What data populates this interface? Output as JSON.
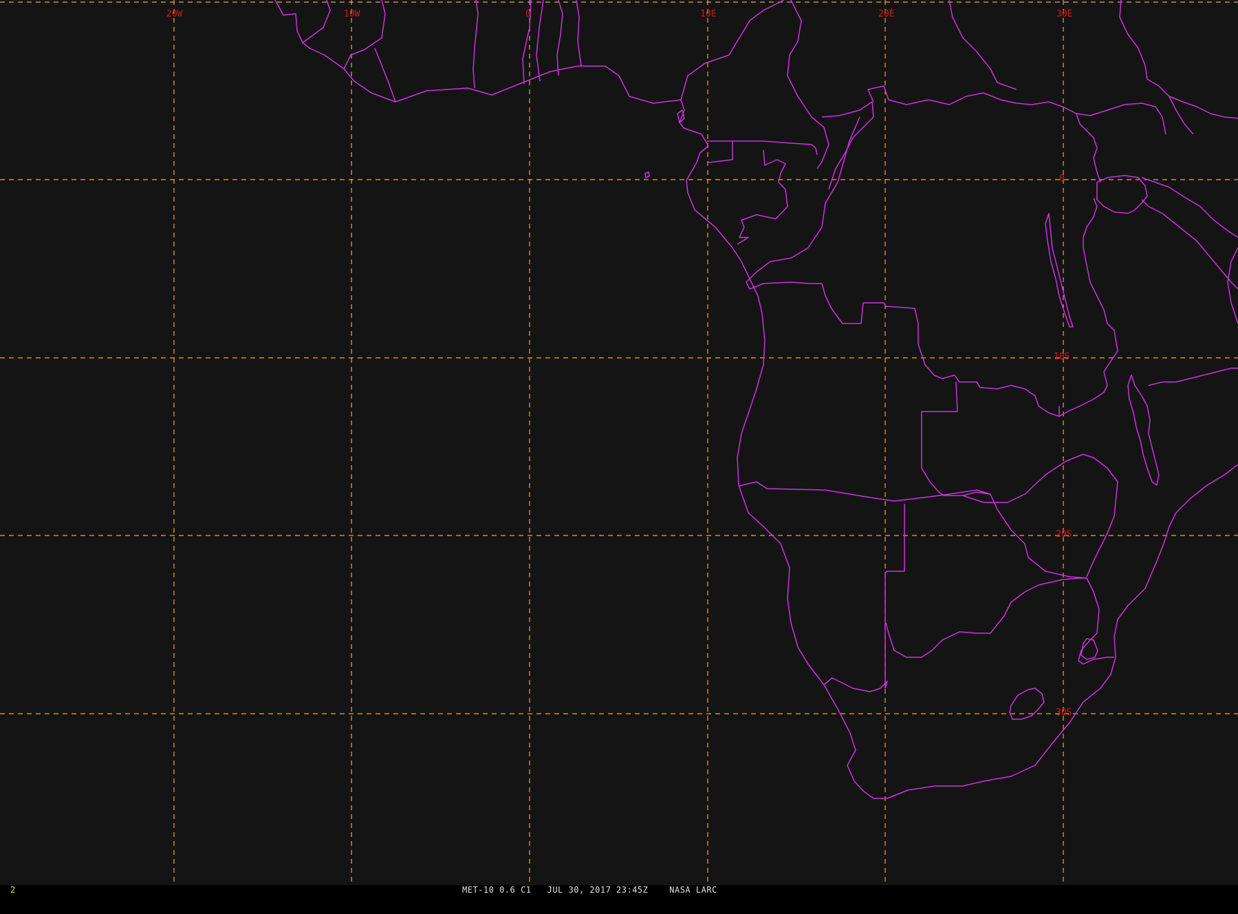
{
  "map": {
    "projection": "satellite view (MET-10)",
    "background_color": "#141414",
    "grid_color": "#f0a050",
    "border_color": "#d030e0",
    "label_color": "#d01818",
    "longitude_labels": [
      "20W",
      "10W",
      "0",
      "10E",
      "20E",
      "30E"
    ],
    "latitude_labels": [
      "0",
      "10S",
      "20S",
      "30S"
    ]
  },
  "status_bar": {
    "frame_number": "2",
    "caption": "MET-10 0.6 C1   JUL 30, 2017 23:45Z    NASA LARC"
  }
}
